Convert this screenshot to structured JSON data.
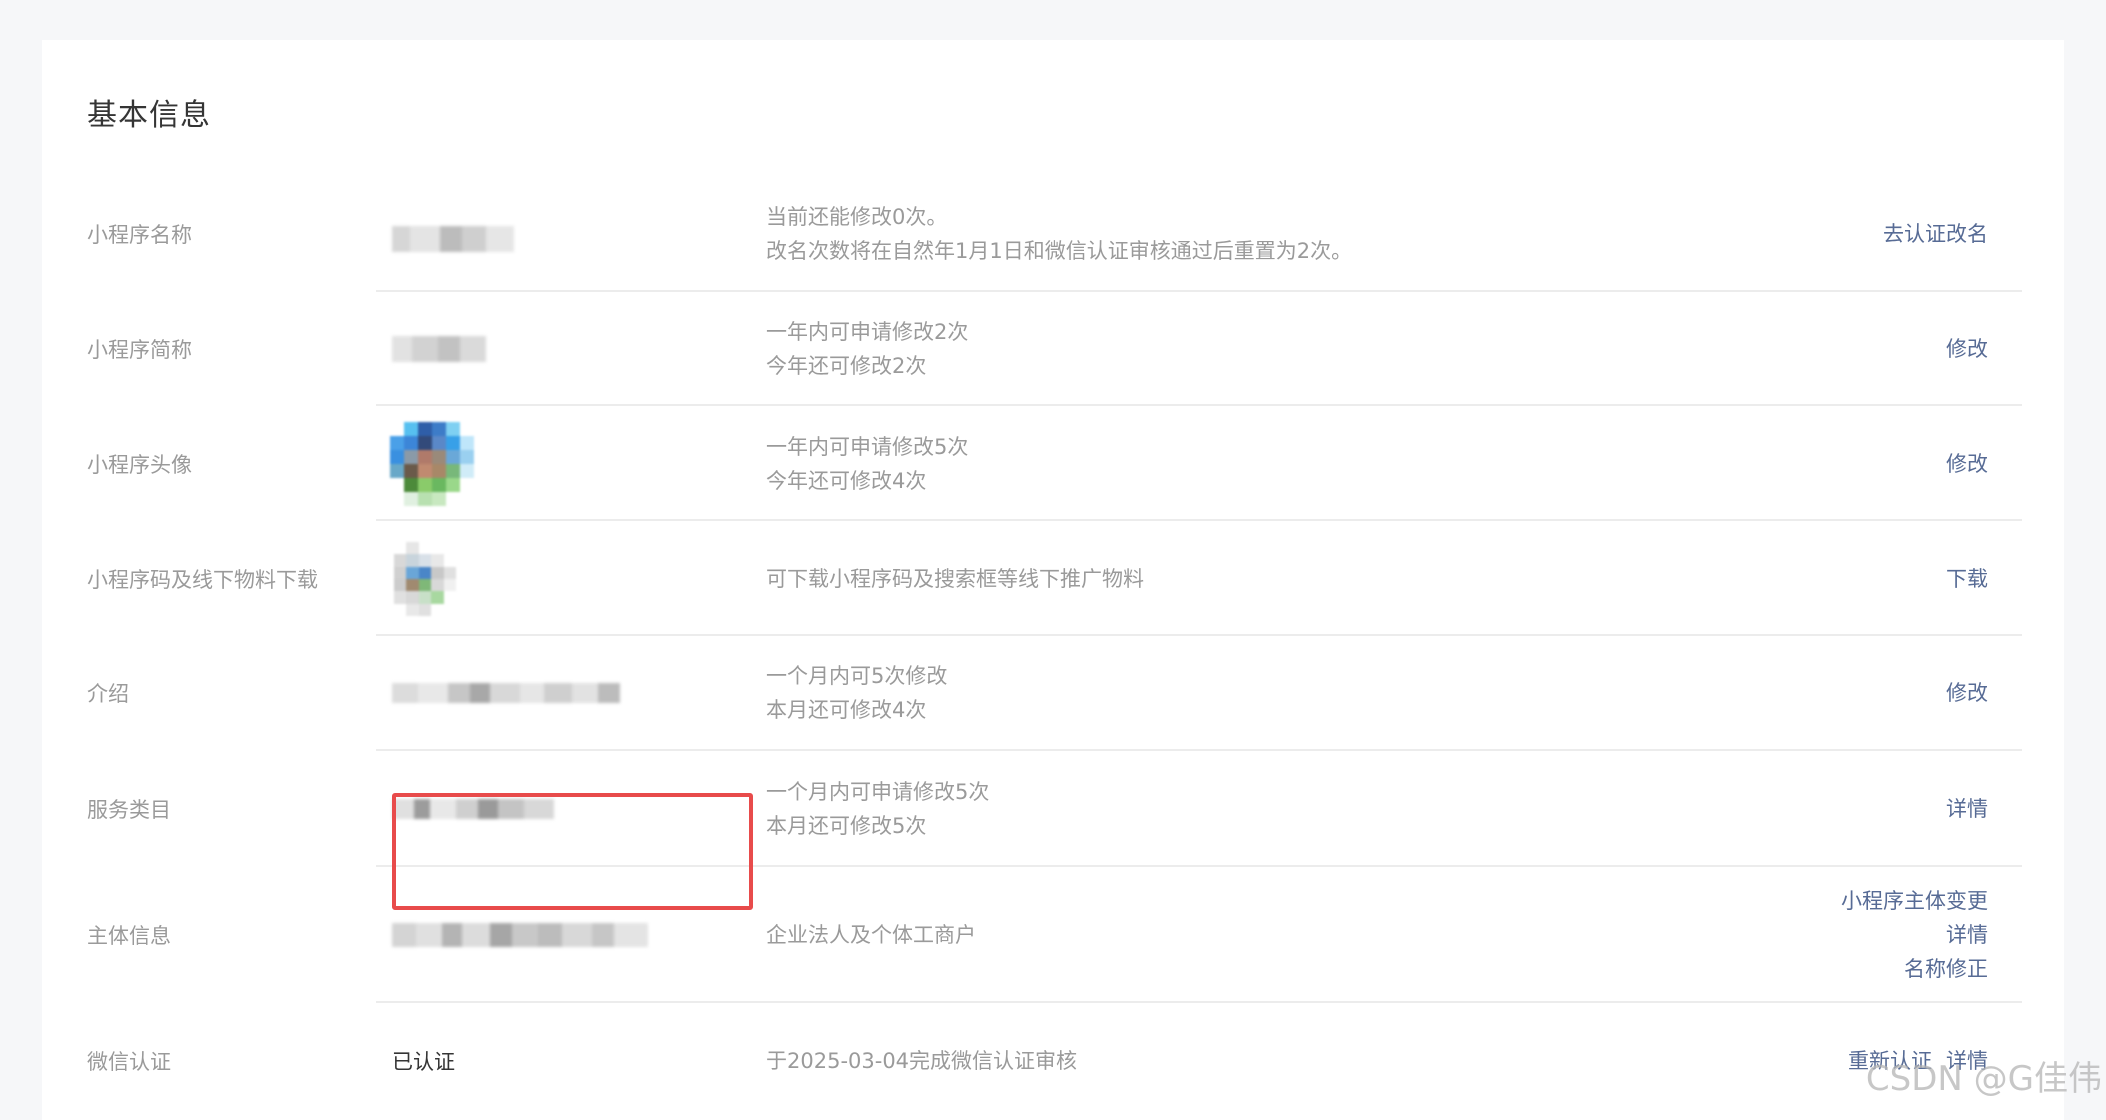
{
  "title": "基本信息",
  "rows": [
    {
      "label": "小程序名称",
      "desc": [
        "当前还能修改0次。",
        "改名次数将在自然年1月1日和微信认证审核通过后重置为2次。"
      ],
      "actions": [
        "去认证改名"
      ]
    },
    {
      "label": "小程序简称",
      "desc": [
        "一年内可申请修改2次",
        "今年还可修改2次"
      ],
      "actions": [
        "修改"
      ]
    },
    {
      "label": "小程序头像",
      "desc": [
        "一年内可申请修改5次",
        "今年还可修改4次"
      ],
      "actions": [
        "修改"
      ]
    },
    {
      "label": "小程序码及线下物料下载",
      "desc": [
        "可下载小程序码及搜索框等线下推广物料"
      ],
      "actions": [
        "下载"
      ]
    },
    {
      "label": "介绍",
      "desc": [
        "一个月内可5次修改",
        "本月还可修改4次"
      ],
      "actions": [
        "修改"
      ]
    },
    {
      "label": "服务类目",
      "desc": [
        "一个月内可申请修改5次",
        "本月还可修改5次"
      ],
      "actions": [
        "详情"
      ]
    },
    {
      "label": "主体信息",
      "desc": [
        "企业法人及个体工商户"
      ],
      "actions": [
        "小程序主体变更",
        "详情",
        "名称修正"
      ]
    },
    {
      "label": "微信认证",
      "value": "已认证",
      "desc": [
        "于2025-03-04完成微信认证审核"
      ],
      "actions": [
        "重新认证",
        "详情"
      ]
    }
  ],
  "watermark": "CSDN @G佳伟",
  "colors": {
    "link": "#576b95",
    "label": "#9a9a9a",
    "highlight": "#e84b4b",
    "background": "#f6f7f9"
  }
}
